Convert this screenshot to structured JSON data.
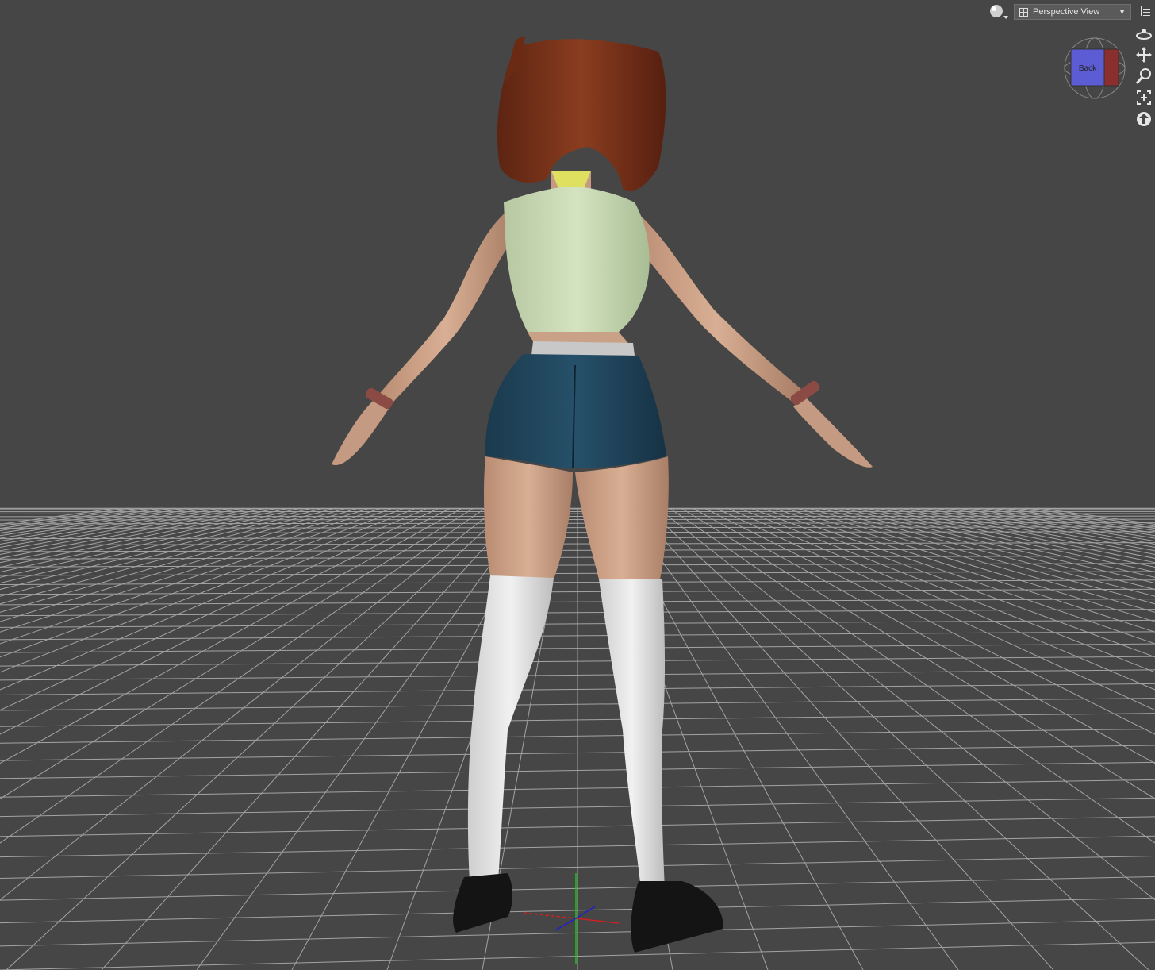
{
  "viewport": {
    "view_label": "Perspective View",
    "dropdown_arrow": "▼",
    "cube_face_label": "Back",
    "background_color": "#464646",
    "grid_color": "#b4b4b4"
  },
  "toolbar": {
    "render_icon": "sphere-render-icon",
    "view_icon": "grid-layout-icon",
    "menu_icon": "options-menu-icon"
  },
  "nav_tools": [
    {
      "name": "orbit-icon"
    },
    {
      "name": "translate-icon"
    },
    {
      "name": "zoom-icon"
    },
    {
      "name": "frame-icon"
    },
    {
      "name": "home-icon"
    }
  ]
}
